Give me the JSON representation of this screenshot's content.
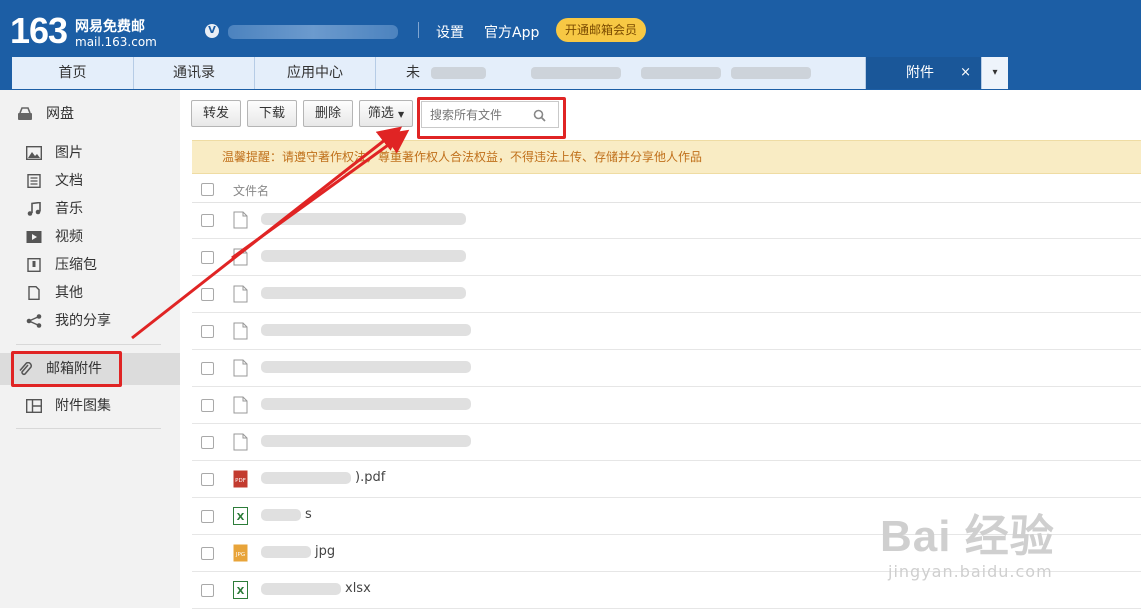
{
  "header": {
    "logo_number": "163",
    "logo_name": "网易免费邮",
    "logo_url": "mail.163.com",
    "user_badge": "V",
    "links": {
      "settings": "设置",
      "app": "官方App"
    },
    "vip_button": "开通邮箱会员"
  },
  "tabs": [
    {
      "label": "首页"
    },
    {
      "label": "通讯录"
    },
    {
      "label": "应用中心"
    },
    {
      "label": "未"
    },
    {
      "label": "附件",
      "active": true,
      "close": "×"
    }
  ],
  "tab_more": "▾",
  "sidebar": {
    "top_item": "网盘",
    "items": [
      {
        "label": "图片",
        "icon": "image-icon"
      },
      {
        "label": "文档",
        "icon": "document-icon"
      },
      {
        "label": "音乐",
        "icon": "music-icon"
      },
      {
        "label": "视频",
        "icon": "video-icon"
      },
      {
        "label": "压缩包",
        "icon": "archive-icon"
      },
      {
        "label": "其他",
        "icon": "file-icon"
      },
      {
        "label": "我的分享",
        "icon": "share-icon"
      }
    ],
    "attachments": "邮箱附件",
    "album": "附件图集"
  },
  "toolbar": {
    "forward": "转发",
    "download": "下载",
    "delete": "删除",
    "filter": "筛选",
    "search_placeholder": "搜索所有文件"
  },
  "notice": "温馨提醒：请遵守著作权法，尊重著作权人合法权益，不得违法上传、存储并分享他人作品",
  "list": {
    "column_name": "文件名",
    "rows": [
      {
        "type": "doc",
        "name": ""
      },
      {
        "type": "doc",
        "name": ""
      },
      {
        "type": "doc",
        "name": ""
      },
      {
        "type": "doc",
        "name": ""
      },
      {
        "type": "doc",
        "name": ""
      },
      {
        "type": "doc",
        "name": ""
      },
      {
        "type": "doc",
        "name": ""
      },
      {
        "type": "pdf",
        "name": ").pdf"
      },
      {
        "type": "xls",
        "name": "s"
      },
      {
        "type": "jpg",
        "name": "jpg"
      },
      {
        "type": "xls",
        "name": "xlsx"
      }
    ]
  },
  "watermark": {
    "text": "Bai 经验",
    "url": "jingyan.baidu.com"
  },
  "colors": {
    "header": "#1c5ea5",
    "active_tab": "#1a5799",
    "vip": "#f7c844",
    "highlight": "#e02424",
    "notice_bg": "#f9ecc4"
  }
}
